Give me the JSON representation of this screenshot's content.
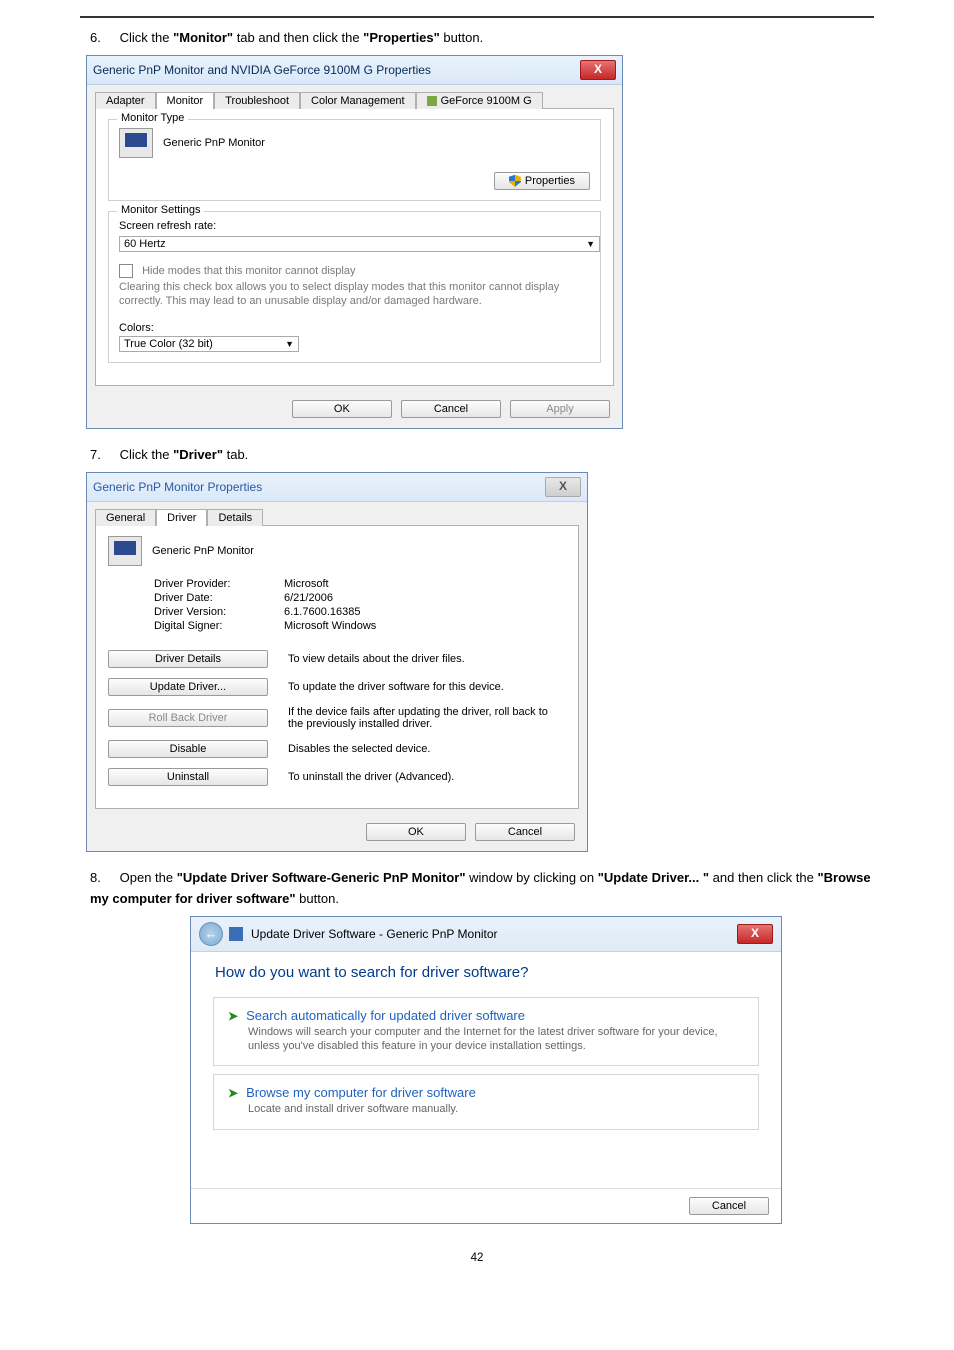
{
  "page_number": "42",
  "steps": {
    "s6_num": "6.",
    "s6_a": "Click the ",
    "s6_b": "\"Monitor\"",
    "s6_c": " tab and then click the ",
    "s6_d": "\"Properties\"",
    "s6_e": " button.",
    "s7_num": "7.",
    "s7_a": "Click the ",
    "s7_b": "\"Driver\"",
    "s7_c": " tab.",
    "s8_num": "8.",
    "s8_a": "Open the ",
    "s8_b": "\"Update Driver Software-Generic PnP Monitor\"",
    "s8_c": " window by clicking on ",
    "s8_d": "\"Update Driver... \"",
    "s8_e": " and then click the ",
    "s8_f": "\"Browse my computer for driver software\"",
    "s8_g": " button."
  },
  "dlg1": {
    "title": "Generic PnP Monitor and NVIDIA GeForce 9100M G   Properties",
    "close": "X",
    "tabs": {
      "adapter": "Adapter",
      "monitor": "Monitor",
      "troubleshoot": "Troubleshoot",
      "color": "Color Management",
      "gpu": "GeForce 9100M G"
    },
    "monitor_type_legend": "Monitor Type",
    "monitor_name": "Generic PnP Monitor",
    "properties_btn": "Properties",
    "settings_legend": "Monitor Settings",
    "refresh_label": "Screen refresh rate:",
    "refresh_value": "60 Hertz",
    "hide_label": "Hide modes that this monitor cannot display",
    "hide_desc": "Clearing this check box allows you to select display modes that this monitor cannot display correctly. This may lead to an unusable display and/or damaged hardware.",
    "colors_label": "Colors:",
    "colors_value": "True Color (32 bit)",
    "ok": "OK",
    "cancel": "Cancel",
    "apply": "Apply"
  },
  "dlg2": {
    "title": "Generic PnP Monitor Properties",
    "close": "X",
    "tabs": {
      "general": "General",
      "driver": "Driver",
      "details": "Details"
    },
    "name": "Generic PnP Monitor",
    "provider_l": "Driver Provider:",
    "provider_v": "Microsoft",
    "date_l": "Driver Date:",
    "date_v": "6/21/2006",
    "version_l": "Driver Version:",
    "version_v": "6.1.7600.16385",
    "signer_l": "Digital Signer:",
    "signer_v": "Microsoft Windows",
    "details_btn": "Driver Details",
    "details_desc": "To view details about the driver files.",
    "update_btn": "Update Driver...",
    "update_desc": "To update the driver software for this device.",
    "rollback_btn": "Roll Back Driver",
    "rollback_desc": "If the device fails after updating the driver, roll back to the previously installed driver.",
    "disable_btn": "Disable",
    "disable_desc": "Disables the selected device.",
    "uninstall_btn": "Uninstall",
    "uninstall_desc": "To uninstall the driver (Advanced).",
    "ok": "OK",
    "cancel": "Cancel"
  },
  "wiz": {
    "title": "Update Driver Software - Generic PnP Monitor",
    "close": "X",
    "heading": "How do you want to search for driver software?",
    "opt1_head": "Search automatically for updated driver software",
    "opt1_sub": "Windows will search your computer and the Internet for the latest driver software for your device, unless you've disabled this feature in your device installation settings.",
    "opt2_head": "Browse my computer for driver software",
    "opt2_sub": "Locate and install driver software manually.",
    "cancel": "Cancel"
  }
}
